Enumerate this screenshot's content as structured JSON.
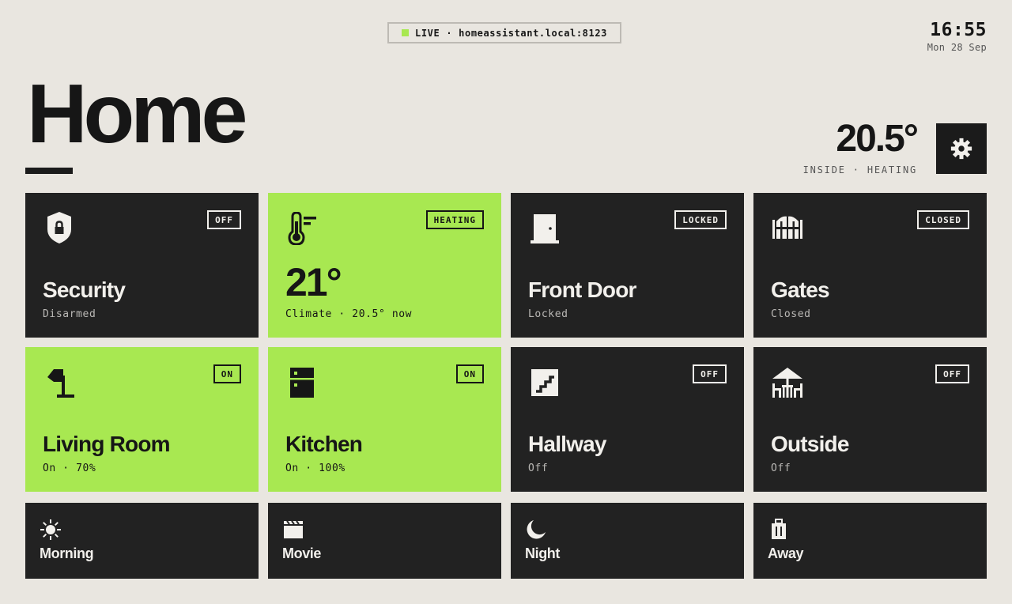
{
  "header": {
    "live_label": "LIVE",
    "separator": "·",
    "host": "homeassistant.local:8123",
    "status_color": "#a8e851"
  },
  "clock": {
    "time": "16:55",
    "date": "Mon 28 Sep"
  },
  "page": {
    "title": "Home"
  },
  "inside": {
    "temperature": "20.5°",
    "caption": "INSIDE · HEATING"
  },
  "settings": {
    "icon": "gear-icon"
  },
  "tiles": [
    {
      "name": "Security",
      "status": "Disarmed",
      "badge": "OFF",
      "icon": "shield-lock-icon",
      "active": false
    },
    {
      "name": "Climate",
      "value": "21°",
      "status": "Climate · 20.5° now",
      "badge": "HEATING",
      "icon": "thermometer-icon",
      "active": true
    },
    {
      "name": "Front Door",
      "status": "Locked",
      "badge": "LOCKED",
      "icon": "door-icon",
      "active": false
    },
    {
      "name": "Gates",
      "status": "Closed",
      "badge": "CLOSED",
      "icon": "gate-icon",
      "active": false
    },
    {
      "name": "Living Room",
      "status": "On · 70%",
      "badge": "ON",
      "icon": "floor-lamp-icon",
      "active": true
    },
    {
      "name": "Kitchen",
      "status": "On · 100%",
      "badge": "ON",
      "icon": "fridge-icon",
      "active": true
    },
    {
      "name": "Hallway",
      "status": "Off",
      "badge": "OFF",
      "icon": "stairs-icon",
      "active": false
    },
    {
      "name": "Outside",
      "status": "Off",
      "badge": "OFF",
      "icon": "patio-icon",
      "active": false
    }
  ],
  "scenes": [
    {
      "name": "Morning",
      "icon": "sun-icon"
    },
    {
      "name": "Movie",
      "icon": "clapperboard-icon"
    },
    {
      "name": "Night",
      "icon": "moon-icon"
    },
    {
      "name": "Away",
      "icon": "luggage-icon"
    }
  ],
  "colors": {
    "accent": "#a8e851",
    "tile_dark": "#222222",
    "background": "#e9e6e0"
  }
}
